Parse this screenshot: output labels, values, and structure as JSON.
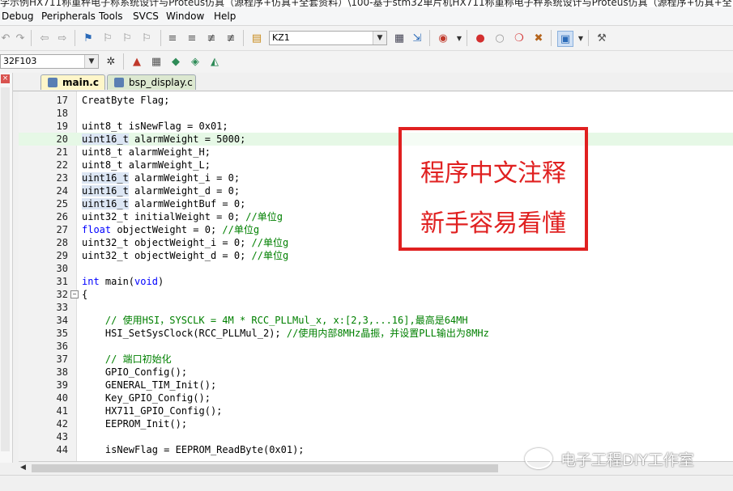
{
  "window": {
    "title_fragment": "学示例HX711称重秤电子称系统设计与Proteus仿真（源程序+仿真+全套资料）\\100-基于stm32单片机HX711称重称电子秤系统设计与Proteus仿真（源程序+仿真+全"
  },
  "menu": {
    "items": [
      "Debug",
      "Peripherals",
      "Tools",
      "SVCS",
      "Window",
      "Help"
    ]
  },
  "toolbar": {
    "target_combo_value": "KZ1",
    "device_combo_value": "32F103"
  },
  "tabs": [
    {
      "label": "main.c",
      "active": true
    },
    {
      "label": "bsp_display.c",
      "active": false
    }
  ],
  "code_lines": [
    {
      "n": "17",
      "text": "CreatByte Flag;"
    },
    {
      "n": "18",
      "text": ""
    },
    {
      "n": "19",
      "text": "uint8_t isNewFlag = 0x01;"
    },
    {
      "n": "20",
      "text": "uint16_t alarmWeight = 5000;"
    },
    {
      "n": "21",
      "text": "uint8_t alarmWeight_H;"
    },
    {
      "n": "22",
      "text": "uint8_t alarmWeight_L;"
    },
    {
      "n": "23",
      "text": "uint16_t alarmWeight_i = 0;"
    },
    {
      "n": "24",
      "text": "uint16_t alarmWeight_d = 0;"
    },
    {
      "n": "25",
      "text": "uint16_t alarmWeightBuf = 0;"
    },
    {
      "n": "26",
      "text": "uint32_t initialWeight = 0; //单位g"
    },
    {
      "n": "27",
      "text": "float objectWeight = 0; //单位g"
    },
    {
      "n": "28",
      "text": "uint32_t objectWeight_i = 0; //单位g"
    },
    {
      "n": "29",
      "text": "uint32_t objectWeight_d = 0; //单位g"
    },
    {
      "n": "30",
      "text": ""
    },
    {
      "n": "31",
      "text": "int main(void)"
    },
    {
      "n": "32",
      "text": "{"
    },
    {
      "n": "33",
      "text": ""
    },
    {
      "n": "34",
      "text": "    // 使用HSI，SYSCLK = 4M * RCC_PLLMul_x, x:[2,3,...16],最高是64MH"
    },
    {
      "n": "35",
      "text": "    HSI_SetSysClock(RCC_PLLMul_2); //使用内部8MHz晶振，并设置PLL输出为8MHz"
    },
    {
      "n": "36",
      "text": ""
    },
    {
      "n": "37",
      "text": "    // 端口初始化"
    },
    {
      "n": "38",
      "text": "    GPIO_Config();"
    },
    {
      "n": "39",
      "text": "    GENERAL_TIM_Init();"
    },
    {
      "n": "40",
      "text": "    Key_GPIO_Config();"
    },
    {
      "n": "41",
      "text": "    HX711_GPIO_Config();"
    },
    {
      "n": "42",
      "text": "    EEPROM_Init();"
    },
    {
      "n": "43",
      "text": ""
    },
    {
      "n": "44",
      "text": "    isNewFlag = EEPROM_ReadByte(0x01);"
    }
  ],
  "annotation": {
    "line1": "程序中文注释",
    "line2": "新手容易看懂",
    "color": "#e02020"
  },
  "watermark": {
    "text": "电子工程DIY工作室"
  },
  "colors": {
    "keyword": "#0000ff",
    "comment": "#008000",
    "current_line": "#e6f8e6"
  }
}
